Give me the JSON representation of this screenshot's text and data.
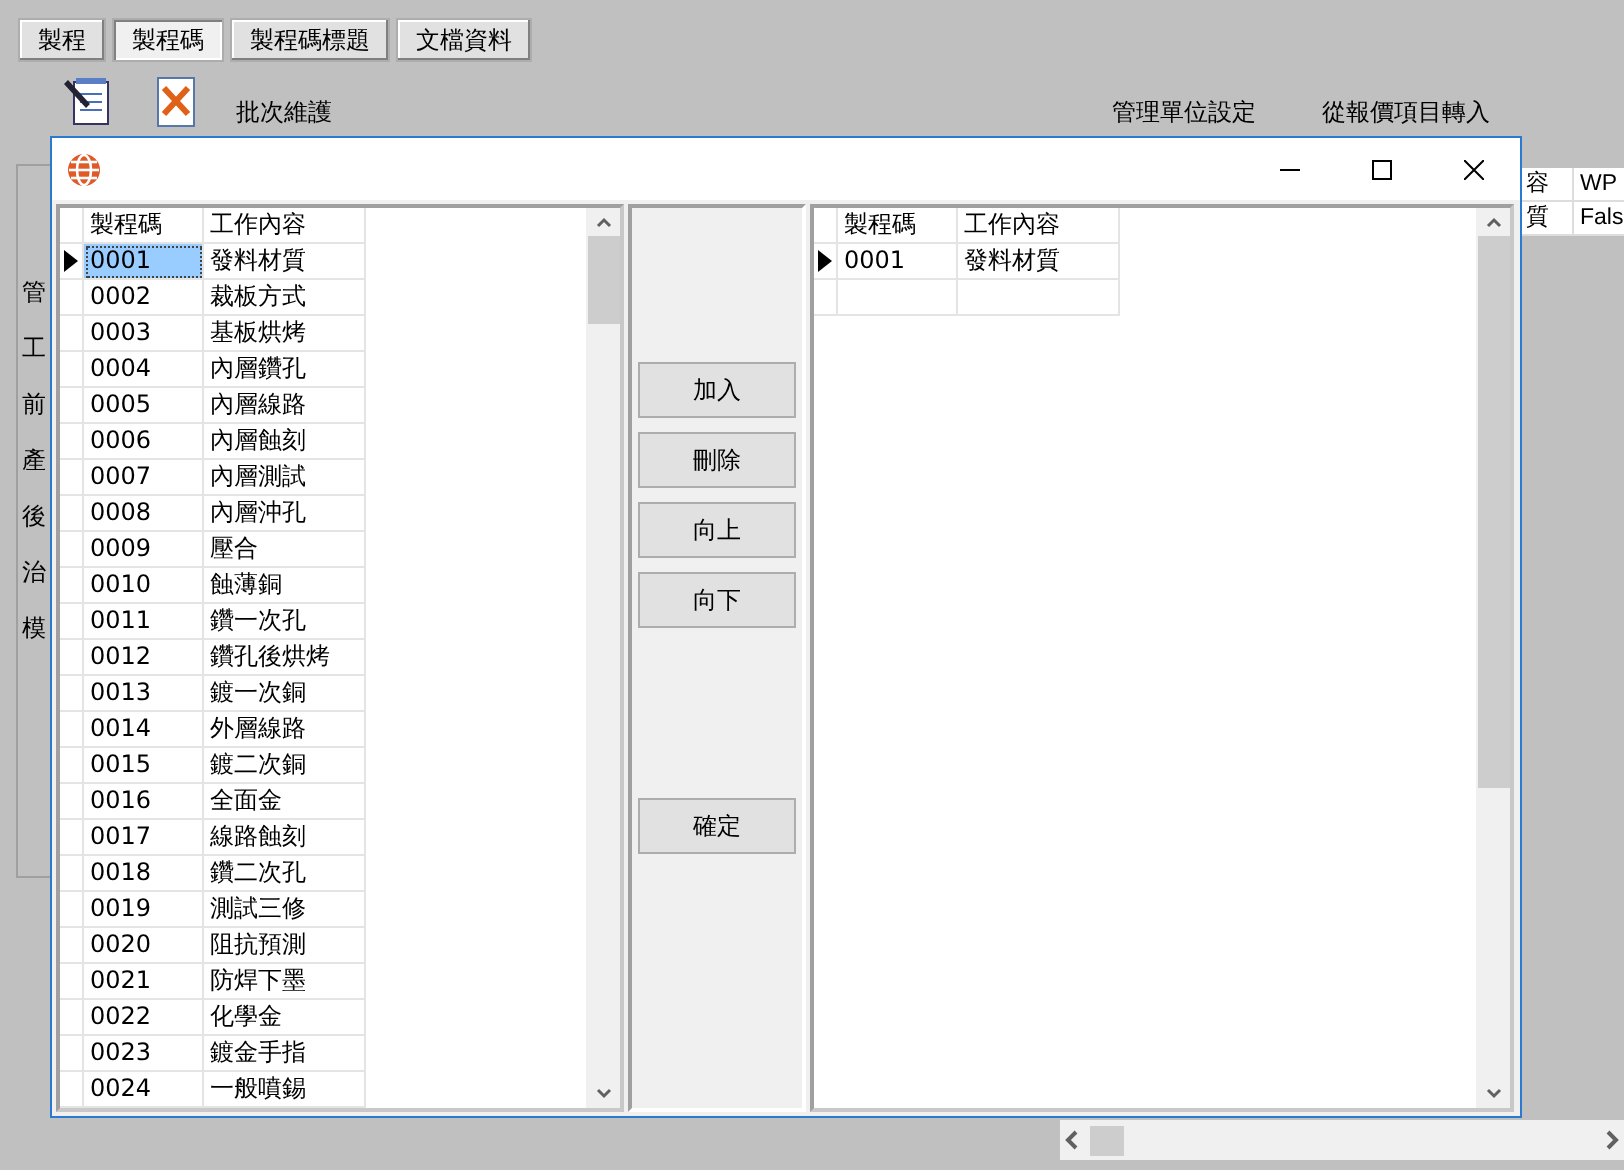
{
  "app": {
    "tabs": [
      {
        "label": "製程",
        "selected": false
      },
      {
        "label": "製程碼",
        "selected": true
      },
      {
        "label": "製程碼標題",
        "selected": false
      },
      {
        "label": "文檔資料",
        "selected": false
      }
    ],
    "toolbar": [
      {
        "kind": "edit"
      },
      {
        "kind": "delete"
      }
    ],
    "actions": [
      "批次維護",
      "管理單位設定",
      "從報價項目轉入"
    ],
    "side_labels": [
      "管",
      "工",
      "前",
      "產",
      "後",
      "治",
      "模"
    ],
    "grid": {
      "columns": [
        "容",
        "WP"
      ],
      "rows": [
        [
          "質",
          "Fals"
        ]
      ]
    }
  },
  "dialog": {
    "left_grid": {
      "focused": true,
      "columns": [
        "製程碼",
        "工作內容"
      ],
      "rows": [
        {
          "code": "0001",
          "content": "發料材質",
          "selected": true
        },
        {
          "code": "0002",
          "content": "裁板方式",
          "selected": false
        },
        {
          "code": "0003",
          "content": "基板烘烤",
          "selected": false
        },
        {
          "code": "0004",
          "content": "內層鑽孔",
          "selected": false
        },
        {
          "code": "0005",
          "content": "內層線路",
          "selected": false
        },
        {
          "code": "0006",
          "content": "內層蝕刻",
          "selected": false
        },
        {
          "code": "0007",
          "content": "內層測試",
          "selected": false
        },
        {
          "code": "0008",
          "content": "內層沖孔",
          "selected": false
        },
        {
          "code": "0009",
          "content": "壓合",
          "selected": false
        },
        {
          "code": "0010",
          "content": "蝕薄銅",
          "selected": false
        },
        {
          "code": "0011",
          "content": "鑽一次孔",
          "selected": false
        },
        {
          "code": "0012",
          "content": "鑽孔後烘烤",
          "selected": false
        },
        {
          "code": "0013",
          "content": "鍍一次銅",
          "selected": false
        },
        {
          "code": "0014",
          "content": "外層線路",
          "selected": false
        },
        {
          "code": "0015",
          "content": "鍍二次銅",
          "selected": false
        },
        {
          "code": "0016",
          "content": "全面金",
          "selected": false
        },
        {
          "code": "0017",
          "content": "線路蝕刻",
          "selected": false
        },
        {
          "code": "0018",
          "content": "鑽二次孔",
          "selected": false
        },
        {
          "code": "0019",
          "content": "測試三修",
          "selected": false
        },
        {
          "code": "0020",
          "content": "阻抗預測",
          "selected": false
        },
        {
          "code": "0021",
          "content": "防焊下墨",
          "selected": false
        },
        {
          "code": "0022",
          "content": "化學金",
          "selected": false
        },
        {
          "code": "0023",
          "content": "鍍金手指",
          "selected": false
        },
        {
          "code": "0024",
          "content": "一般噴錫",
          "selected": false
        }
      ]
    },
    "buttons": [
      {
        "label": "加入",
        "kind": "move"
      },
      {
        "label": "刪除",
        "kind": "move"
      },
      {
        "label": "向上",
        "kind": "move"
      },
      {
        "label": "向下",
        "kind": "move"
      },
      {
        "label": "確定",
        "kind": "confirm"
      }
    ],
    "right_grid": {
      "focused": false,
      "columns": [
        "製程碼",
        "工作內容"
      ],
      "rows": [
        {
          "code": "0001",
          "content": "發料材質",
          "selected": true
        }
      ]
    }
  }
}
